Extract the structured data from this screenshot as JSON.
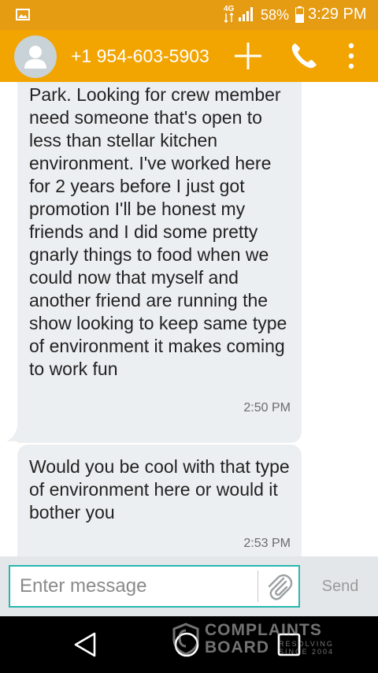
{
  "colors": {
    "status_bar": "#e59b12",
    "action_bar": "#f2a400",
    "bubble_incoming": "#eceff1",
    "input_border": "#29b7b0",
    "composer_bg": "#e4e7e9",
    "nav_bar": "#000000"
  },
  "status_bar": {
    "network_label": "4G",
    "battery_percent": "58%",
    "time": "3:29 PM",
    "icons": [
      "gallery-icon",
      "network-4g-icon",
      "signal-icon",
      "battery-icon"
    ]
  },
  "action_bar": {
    "contact": "+1 954-603-5903",
    "icons": [
      "avatar-icon",
      "plus-icon",
      "phone-icon",
      "more-vert-icon"
    ]
  },
  "messages": [
    {
      "text": "Park. Looking for crew member need someone that's open to less than stellar kitchen environment. I've worked here for 2 years before I just got promotion I'll be honest my friends and I did some pretty gnarly things to food when we could now that myself and another friend are running the show looking to keep same type of environment it makes coming to work fun",
      "time": "2:50 PM",
      "direction": "incoming"
    },
    {
      "text": "Would you be cool with that type of environment here or would it bother you",
      "time": "2:53 PM",
      "direction": "incoming"
    }
  ],
  "composer": {
    "placeholder": "Enter message",
    "value": "",
    "send_label": "Send",
    "icons": [
      "paperclip-icon"
    ]
  },
  "nav_bar": {
    "icons": [
      "back-icon",
      "home-icon",
      "recents-icon"
    ]
  },
  "watermark": {
    "line1": "COMPLAINTS",
    "line2": "BOARD",
    "tagline": "RESOLVING SINCE 2004"
  }
}
